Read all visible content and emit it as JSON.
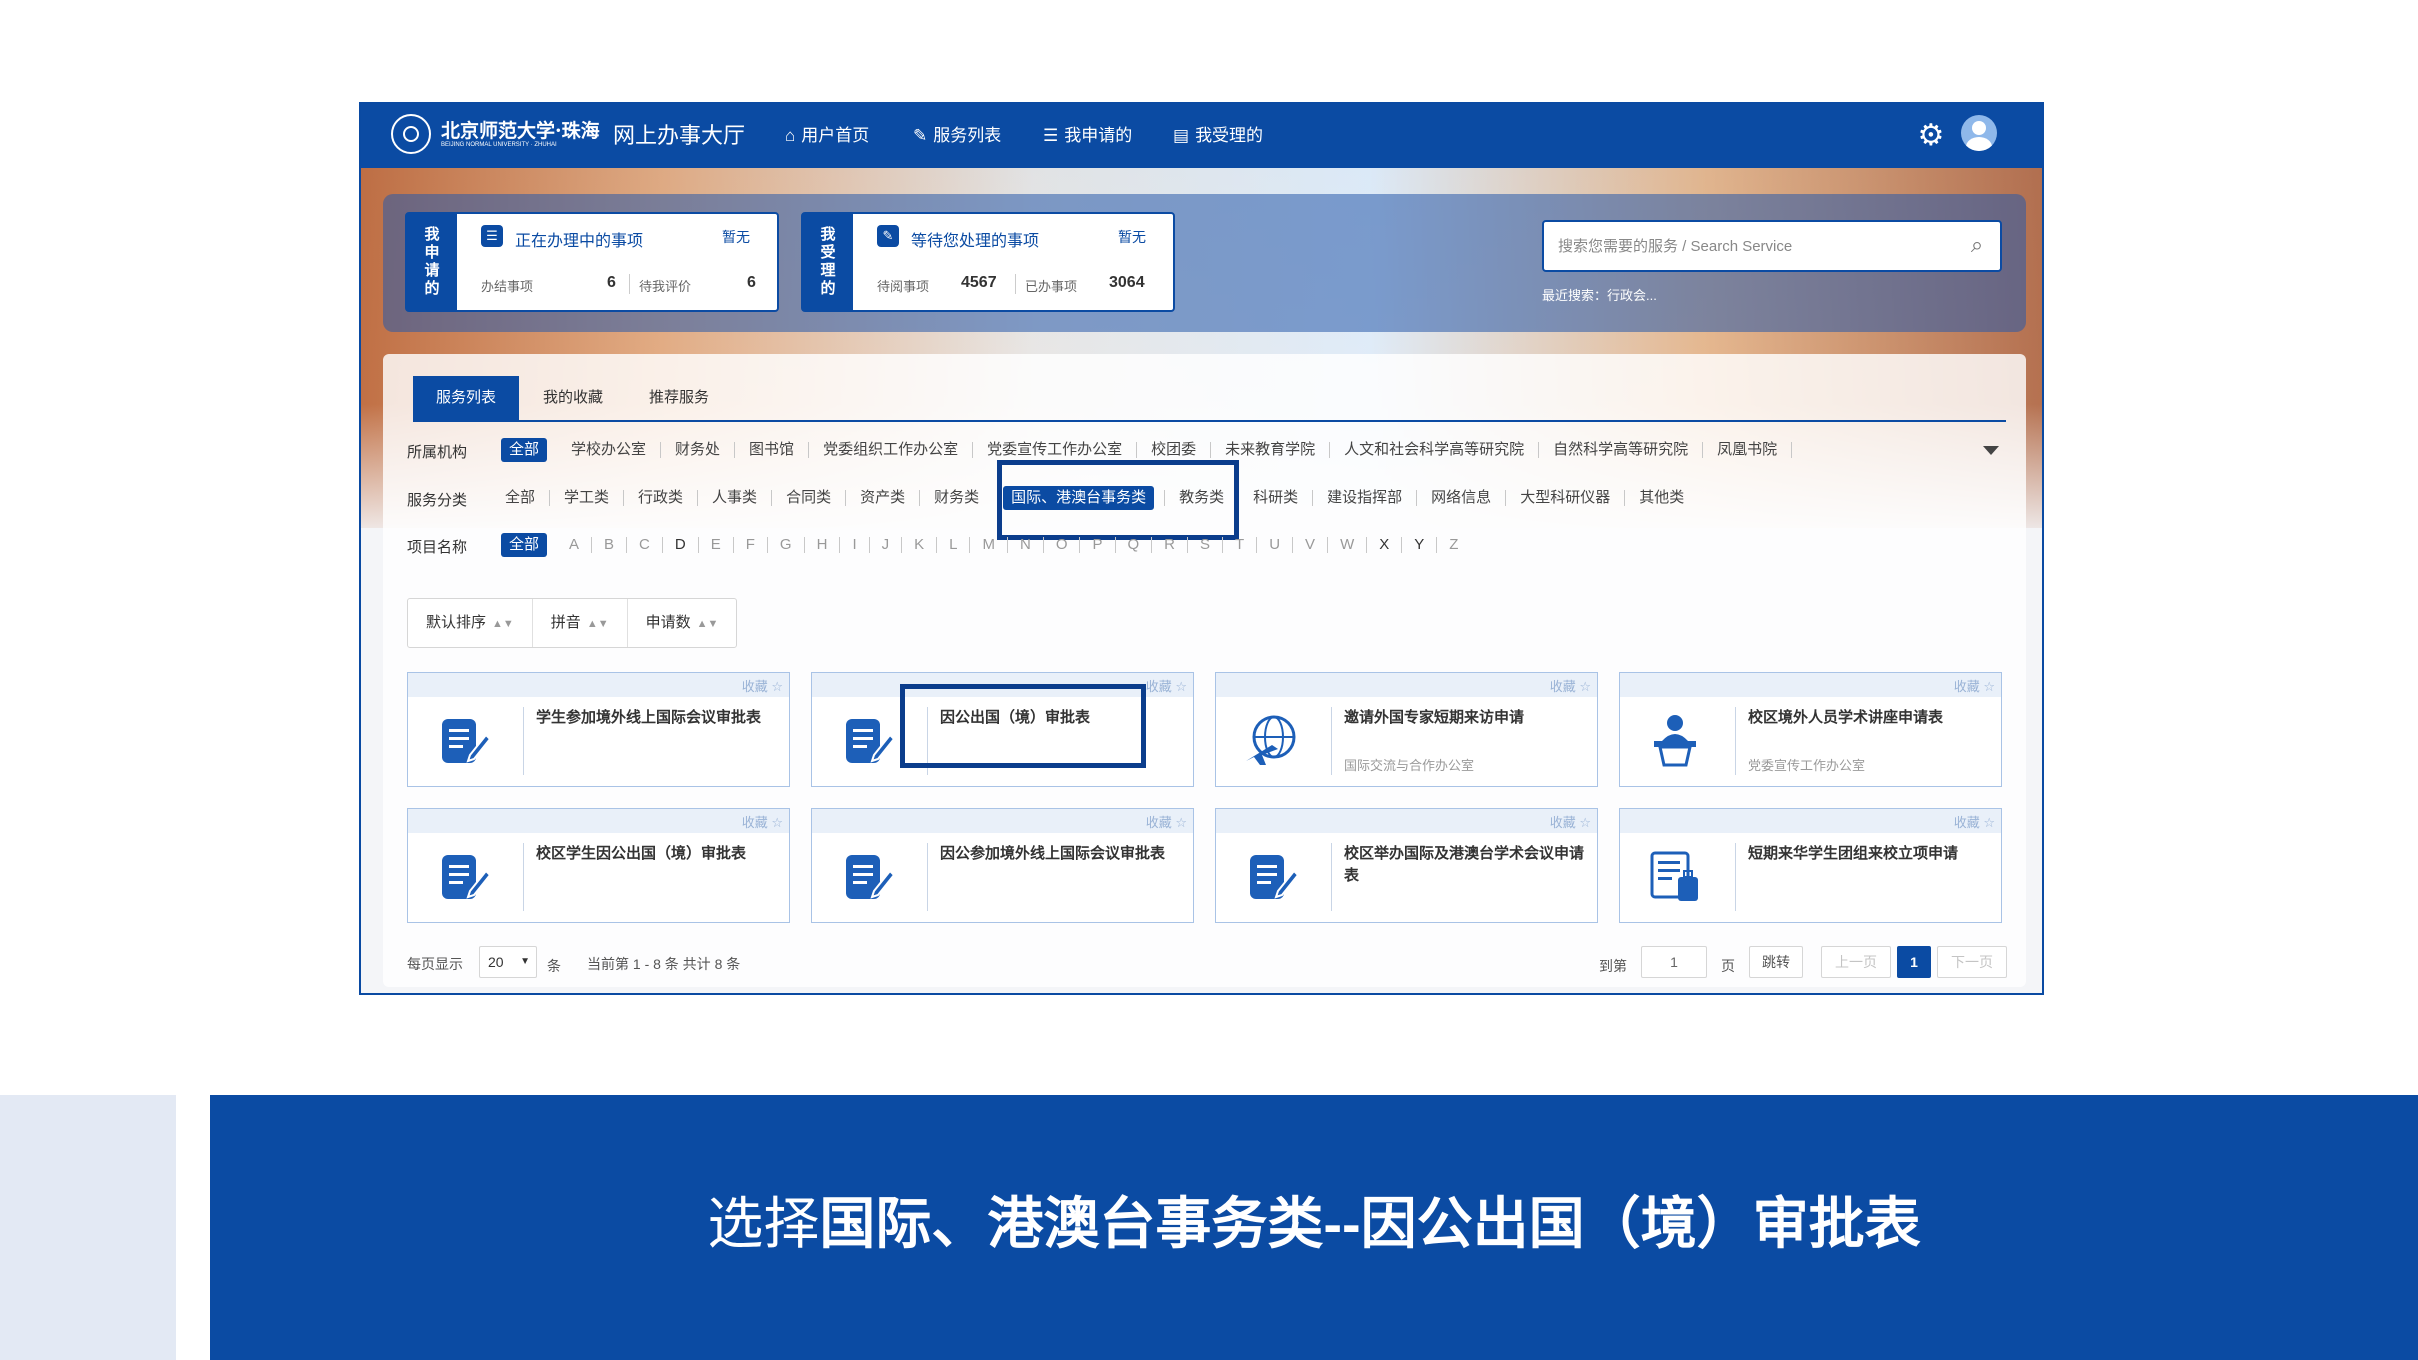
{
  "topbar": {
    "school_name": "北京师范大学·珠海",
    "school_en": "BEIJING NORMAL UNIVERSITY · ZHUHAI",
    "separator": "·",
    "portal_title": "网上办事大厅",
    "nav": [
      {
        "icon": "home-icon",
        "label": "用户首页"
      },
      {
        "icon": "edit-icon",
        "label": "服务列表"
      },
      {
        "icon": "list-icon",
        "label": "我申请的"
      },
      {
        "icon": "inbox-icon",
        "label": "我受理的"
      }
    ]
  },
  "stats": {
    "applied": {
      "side": "我申请的",
      "title": "正在办理中的事项",
      "badge": "暂无",
      "label1": "办结事项",
      "value1": "6",
      "label2": "待我评价",
      "value2": "6"
    },
    "handled": {
      "side": "我受理的",
      "title": "等待您处理的事项",
      "badge": "暂无",
      "label1": "待阅事项",
      "value1": "4567",
      "label2": "已办事项",
      "value2": "3064"
    }
  },
  "search": {
    "placeholder": "搜索您需要的服务 / Search Service",
    "recent": "最近搜索：行政会..."
  },
  "tabs": [
    "服务列表",
    "我的收藏",
    "推荐服务"
  ],
  "filters": {
    "org_label": "所属机构",
    "org_items": [
      "全部",
      "学校办公室",
      "财务处",
      "图书馆",
      "党委组织工作办公室",
      "党委宣传工作办公室",
      "校团委",
      "未来教育学院",
      "人文和社会科学高等研究院",
      "自然科学高等研究院",
      "凤凰书院"
    ],
    "category_label": "服务分类",
    "category_items": [
      "全部",
      "学工类",
      "行政类",
      "人事类",
      "合同类",
      "资产类",
      "财务类",
      "国际、港澳台事务类",
      "教务类",
      "科研类",
      "建设指挥部",
      "网络信息",
      "大型科研仪器",
      "其他类"
    ],
    "name_label": "项目名称",
    "name_all": "全部",
    "letters": [
      "A",
      "B",
      "C",
      "D",
      "E",
      "F",
      "G",
      "H",
      "I",
      "J",
      "K",
      "L",
      "M",
      "N",
      "O",
      "P",
      "Q",
      "R",
      "S",
      "T",
      "U",
      "V",
      "W",
      "X",
      "Y",
      "Z"
    ]
  },
  "sort": [
    {
      "label": "默认排序",
      "caret": "▲▼"
    },
    {
      "label": "拼音",
      "caret": "▲▼"
    },
    {
      "label": "申请数",
      "caret": "▲▼"
    }
  ],
  "fav_label": "收藏 ☆",
  "services": [
    {
      "title": "学生参加境外线上国际会议审批表",
      "sub": "",
      "icon": "document-edit-icon"
    },
    {
      "title": "因公出国（境）审批表",
      "sub": "",
      "icon": "document-edit-icon"
    },
    {
      "title": "邀请外国专家短期来访申请",
      "sub": "国际交流与合作办公室",
      "icon": "globe-plane-icon"
    },
    {
      "title": "校区境外人员学术讲座申请表",
      "sub": "党委宣传工作办公室",
      "icon": "speaker-podium-icon"
    },
    {
      "title": "校区学生因公出国（境）审批表",
      "sub": "",
      "icon": "document-edit-icon"
    },
    {
      "title": "因公参加境外线上国际会议审批表",
      "sub": "",
      "icon": "document-edit-icon"
    },
    {
      "title": "校区举办国际及港澳台学术会议申请表",
      "sub": "",
      "icon": "document-edit-icon"
    },
    {
      "title": "短期来华学生团组来校立项申请",
      "sub": "",
      "icon": "document-luggage-icon"
    }
  ],
  "pagination": {
    "per_page_label": "每页显示",
    "per_page_value": "20",
    "per_page_unit": "条",
    "summary": "当前第 1 - 8 条 共计 8 条",
    "goto_label": "到第",
    "goto_value": "1",
    "page_unit": "页",
    "jump": "跳转",
    "prev": "上一页",
    "current": "1",
    "next": "下一页"
  },
  "caption": {
    "prefix": "选择",
    "bold": "国际、港澳台事务类--因公出国（境）审批表"
  },
  "colors": {
    "primary": "#0b4ba3",
    "highlight_box": "#0b3d8c"
  }
}
